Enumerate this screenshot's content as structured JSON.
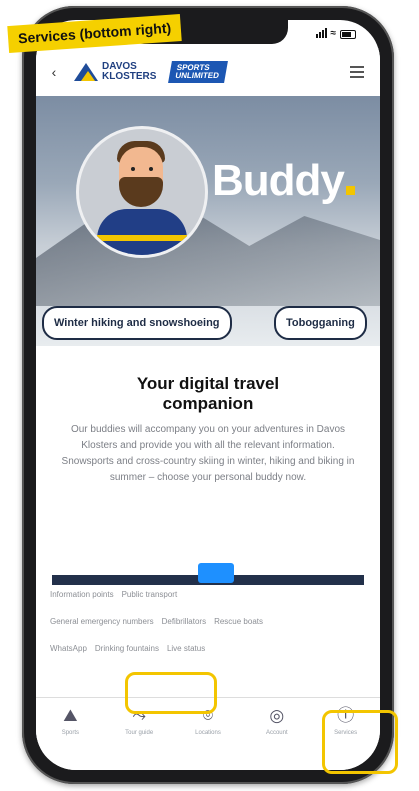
{
  "banner": {
    "text": "Services (bottom right)"
  },
  "header": {
    "logo_line1": "DAVOS",
    "logo_line2": "KLOSTERS",
    "sports_line1": "SPORTS",
    "sports_line2": "UNLIMITED"
  },
  "hero": {
    "title": "Buddy",
    "chips": [
      "Winter hiking and snowshoeing",
      "Tobogganing"
    ]
  },
  "intro": {
    "title_line1": "Your digital travel",
    "title_line2": "companion",
    "description": "Our buddies will accompany you on your adventures in Davos Klosters and provide you with all the relevant information. Snowsports and cross-country skiing in winter, hiking and biking in summer – choose your personal buddy now."
  },
  "links": {
    "row1": [
      "Information points",
      "Public transport"
    ],
    "row2": [
      "General emergency numbers",
      "Defibrillators",
      "Rescue boats"
    ],
    "row3": [
      "WhatsApp",
      "Drinking fountains",
      "Live status"
    ]
  },
  "tabbar": {
    "items": [
      {
        "icon": "mountain-icon",
        "label": "Sports"
      },
      {
        "icon": "route-icon",
        "label": "Tour guide"
      },
      {
        "icon": "location-pin-icon",
        "label": "Locations"
      },
      {
        "icon": "account-icon",
        "label": "Account"
      },
      {
        "icon": "info-icon",
        "label": "Services"
      }
    ]
  },
  "colors": {
    "accent": "#f3c500",
    "brand": "#1f4c99"
  }
}
